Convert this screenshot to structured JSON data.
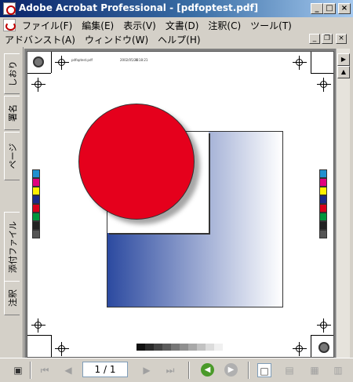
{
  "window": {
    "title": "Adobe Acrobat Professional - [pdfoptest.pdf]",
    "buttons": {
      "minimize": "_",
      "maximize": "□",
      "close": "×"
    }
  },
  "menu": {
    "row1": [
      "ファイル(F)",
      "編集(E)",
      "表示(V)",
      "文書(D)",
      "注釈(C)",
      "ツール(T)"
    ],
    "row2": [
      "アドバンスト(A)",
      "ウィンドウ(W)",
      "ヘルプ(H)"
    ],
    "doc_buttons": {
      "minimize": "_",
      "restore": "❐",
      "close": "×"
    }
  },
  "nav_tabs": [
    "しおり",
    "署名",
    "ページ",
    "添付ファイル",
    "注釈"
  ],
  "document": {
    "header_text": "pdfoptest.pdf",
    "header_date": "2002/05/24",
    "header_time": "6:18:21",
    "colors": {
      "circle": "#e5001c",
      "gradient_dark": "#2c4aa0",
      "gradient_light": "#ffffff"
    },
    "color_bar": [
      "#2090d0",
      "#e0007f",
      "#fff000",
      "#1b2a8a",
      "#d8001c",
      "#00963c",
      "#222222",
      "#555555"
    ],
    "grey_bar": [
      "#111111",
      "#2a2a2a",
      "#444444",
      "#5c5c5c",
      "#777777",
      "#8f8f8f",
      "#a8a8a8",
      "#c2c2c2",
      "#dcdcdc",
      "#f0f0f0"
    ]
  },
  "bottom_bar": {
    "page_field": "1 / 1",
    "first_icon": "first-page",
    "prev_icon": "previous-page",
    "next_icon": "next-page",
    "last_icon": "last-page",
    "back_icon": "go-back",
    "forward_icon": "go-forward"
  }
}
